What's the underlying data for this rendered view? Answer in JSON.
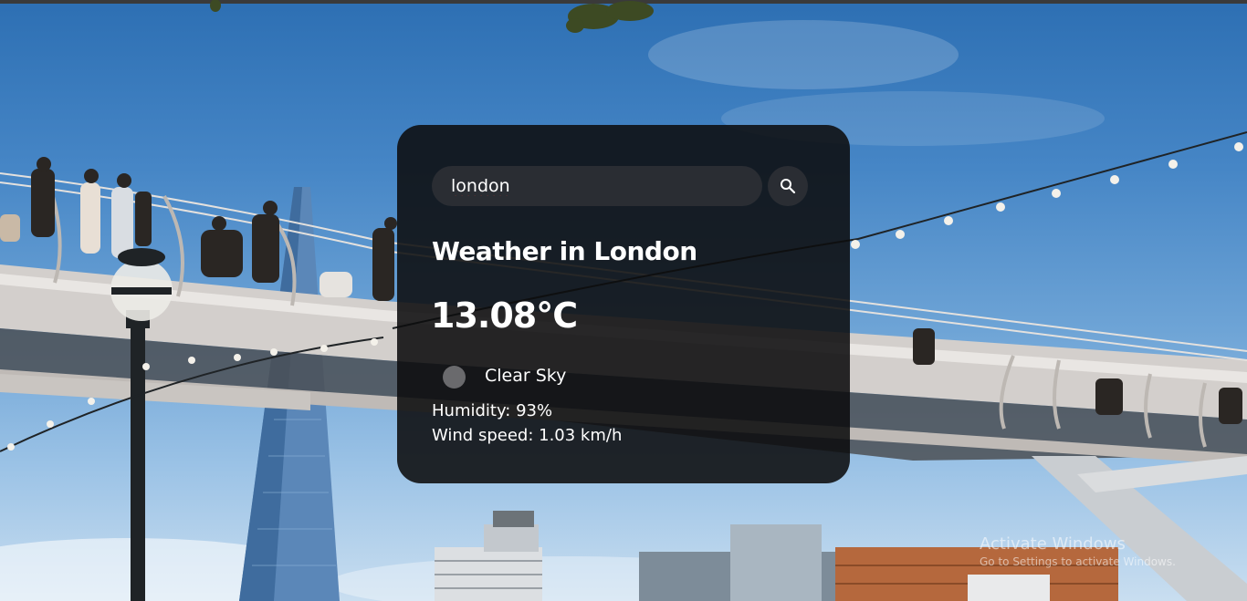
{
  "search": {
    "value": "london",
    "placeholder": "Search"
  },
  "weather": {
    "title": "Weather in London",
    "temperature": "13.08°C",
    "condition": "Clear Sky",
    "humidity": "Humidity: 93%",
    "wind": "Wind speed: 1.03 km/h"
  },
  "icons": {
    "search": "search-icon",
    "condition": "weather-condition-icon"
  },
  "watermark": {
    "title": "Activate Windows",
    "subtitle": "Go to Settings to activate Windows."
  },
  "colors": {
    "card_background": "#0c0c0e",
    "input_background": "#2a2d33",
    "text": "#ffffff"
  }
}
